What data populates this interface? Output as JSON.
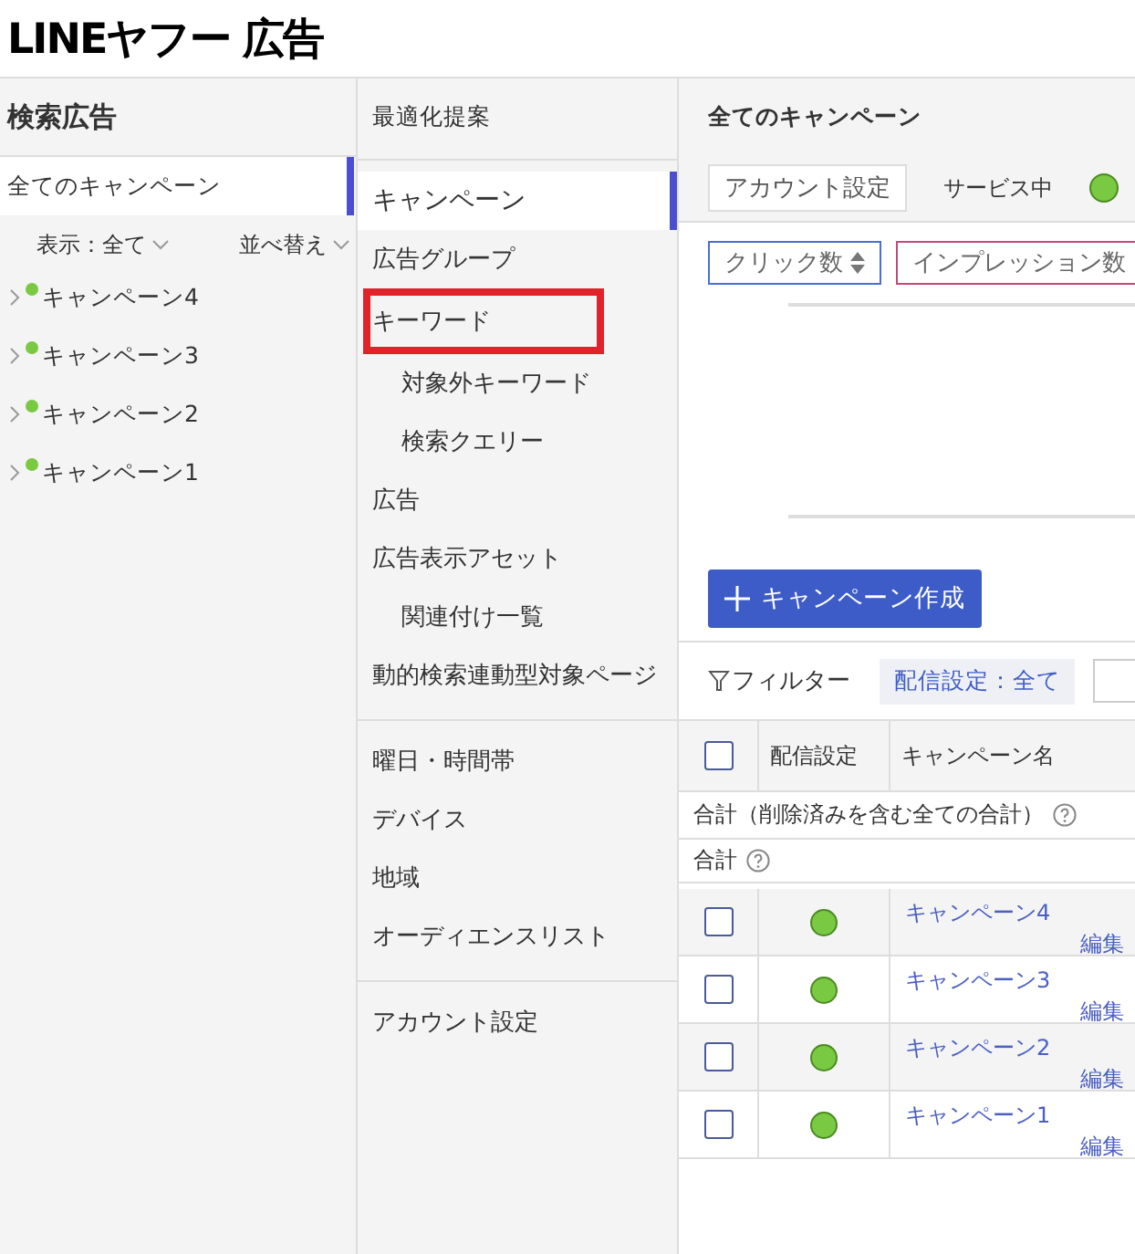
{
  "header": {
    "logo": "LINEヤフー 広告"
  },
  "sidebar": {
    "title": "検索広告",
    "all_campaigns": {
      "label": "全てのキャンペーン",
      "selected": true
    },
    "filters": [
      "表示：全て",
      "並べ替え"
    ],
    "campaigns": [
      {
        "label": "キャンペーン4",
        "color": "#7ac943"
      },
      {
        "label": "キャンペーン3",
        "color": "#7ac943"
      },
      {
        "label": "キャンペーン2",
        "color": "#7ac943"
      },
      {
        "label": "キャンペーン1",
        "color": "#7ac943"
      }
    ]
  },
  "nav": {
    "top": "最適化提案",
    "groups": [
      [
        {
          "label": "キャンペーン",
          "selected": true,
          "highlighted": false
        },
        {
          "label": "広告グループ",
          "selected": false,
          "highlighted": false
        },
        {
          "label": "キーワード",
          "selected": false,
          "highlighted": true,
          "children": [
            {
              "label": "対象外キーワード",
              "selected": false,
              "highlighted": false
            },
            {
              "label": "検索クエリー",
              "selected": false,
              "highlighted": false
            }
          ]
        },
        {
          "label": "広告",
          "selected": false,
          "highlighted": false
        },
        {
          "label": "広告表示アセット",
          "selected": false,
          "highlighted": false,
          "children": [
            {
              "label": "関連付け一覧",
              "selected": false,
              "highlighted": false
            }
          ]
        },
        {
          "label": "動的検索連動型対象ページ",
          "selected": false,
          "highlighted": false
        }
      ],
      [
        {
          "label": "曜日・時間帯",
          "selected": false,
          "highlighted": false
        },
        {
          "label": "デバイス",
          "selected": false,
          "highlighted": false
        },
        {
          "label": "地域",
          "selected": false,
          "highlighted": false
        },
        {
          "label": "オーディエンスリスト",
          "selected": false,
          "highlighted": false
        }
      ],
      [
        {
          "label": "アカウント設定",
          "selected": false,
          "highlighted": false
        }
      ]
    ]
  },
  "main": {
    "title": "全てのキャンペーン",
    "account_button": "アカウント設定",
    "status": {
      "label": "サービス中",
      "color": "#7ac943"
    },
    "metric_selectors": [
      {
        "label": "クリック数",
        "color": "#4a6fd0",
        "sort": true
      },
      {
        "label": "インプレッション数",
        "color": "#c2497a",
        "sort": false
      }
    ],
    "create_button": "キャンペーン作成",
    "filter_button": "フィルター",
    "filter_chip": "配信設定：全て",
    "table": {
      "header_checked": false,
      "columns": [
        "配信設定",
        "キャンペーン名"
      ],
      "totals": [
        {
          "label": "合計（削除済みを含む全ての合計）"
        },
        {
          "label": "合計"
        }
      ],
      "rows": [
        {
          "checked": false,
          "color": "#7ac943",
          "name": "キャンペーン4",
          "edit": "編集"
        },
        {
          "checked": false,
          "color": "#7ac943",
          "name": "キャンペーン3",
          "edit": "編集"
        },
        {
          "checked": false,
          "color": "#7ac943",
          "name": "キャンペーン2",
          "edit": "編集"
        },
        {
          "checked": false,
          "color": "#7ac943",
          "name": "キャンペーン1",
          "edit": "編集"
        }
      ]
    }
  }
}
